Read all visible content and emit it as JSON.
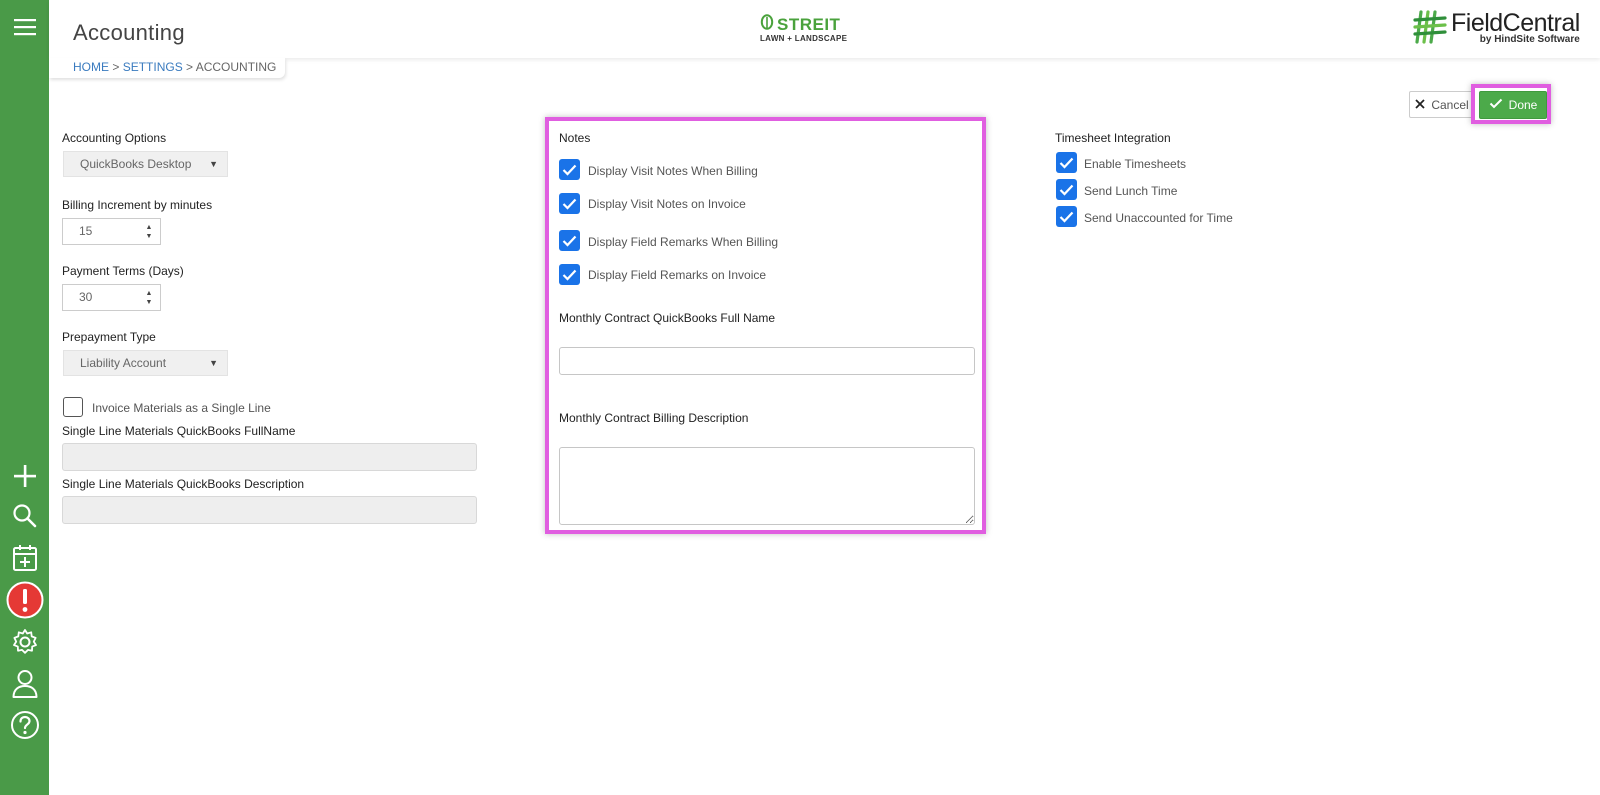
{
  "app": {
    "title": "Accounting"
  },
  "breadcrumb": {
    "home": "HOME",
    "sep1": " > ",
    "settings": "SETTINGS",
    "sep2": " > ",
    "current": "ACCOUNTING"
  },
  "logos": {
    "company_name": "STREIT",
    "company_sub": "LAWN + LANDSCAPE",
    "brand_name": "FieldCentral",
    "brand_by": "by HindSite Software"
  },
  "actions": {
    "cancel_label": "Cancel",
    "done_label": "Done"
  },
  "sidebar": {
    "items": [
      "menu-icon",
      "add-icon",
      "search-icon",
      "calendar-add-icon",
      "alert-icon",
      "gear-icon",
      "user-icon",
      "help-icon"
    ]
  },
  "accounting": {
    "options_label": "Accounting Options",
    "options_value": "QuickBooks Desktop",
    "increment_label": "Billing Increment by minutes",
    "increment_value": "15",
    "terms_label": "Payment Terms (Days)",
    "terms_value": "30",
    "prepay_label": "Prepayment Type",
    "prepay_value": "Liability Account",
    "single_line_label": "Invoice Materials as a Single Line",
    "single_line_checked": false,
    "single_fullname_label": "Single Line Materials QuickBooks FullName",
    "single_desc_label": "Single Line Materials QuickBooks Description"
  },
  "notes": {
    "heading": "Notes",
    "items": [
      {
        "label": "Display Visit Notes When Billing",
        "checked": true
      },
      {
        "label": "Display Visit Notes on Invoice",
        "checked": true
      },
      {
        "label": "Display Field Remarks When Billing",
        "checked": true
      },
      {
        "label": "Display Field Remarks on Invoice",
        "checked": true
      }
    ],
    "contract_fullname_label": "Monthly Contract QuickBooks Full Name",
    "contract_fullname_value": "",
    "contract_desc_label": "Monthly Contract Billing Description",
    "contract_desc_value": ""
  },
  "timesheet": {
    "heading": "Timesheet Integration",
    "items": [
      {
        "label": "Enable Timesheets",
        "checked": true
      },
      {
        "label": "Send Lunch Time",
        "checked": true
      },
      {
        "label": "Send Unaccounted for Time",
        "checked": true
      }
    ]
  },
  "colors": {
    "sidebar": "#4a9a48",
    "accent_green": "#4caa4a",
    "checkbox_blue": "#1a73e8",
    "highlight": "#e05ee0",
    "alert_red": "#e53935"
  }
}
